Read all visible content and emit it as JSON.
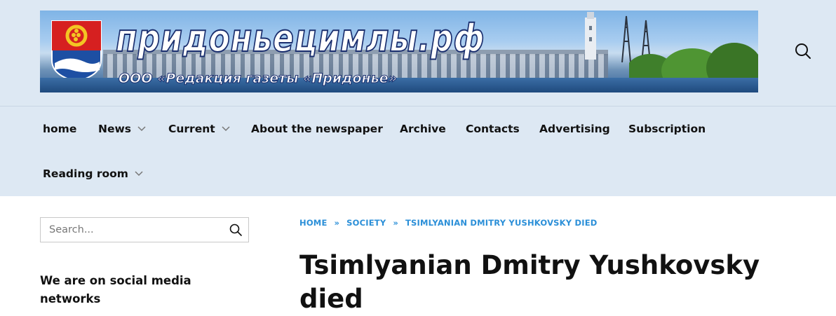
{
  "header": {
    "site_title": "придоньецимлы.рф",
    "site_subtitle": "ООО «Редакция газеты «Придонье»",
    "search_icon": "search-icon"
  },
  "nav": {
    "items": [
      {
        "label": "home",
        "has_dropdown": false
      },
      {
        "label": "News",
        "has_dropdown": true
      },
      {
        "label": "Current",
        "has_dropdown": true
      },
      {
        "label": "About the newspaper",
        "has_dropdown": false
      },
      {
        "label": "Archive",
        "has_dropdown": false
      },
      {
        "label": "Contacts",
        "has_dropdown": false
      },
      {
        "label": "Advertising",
        "has_dropdown": false
      },
      {
        "label": "Subscription",
        "has_dropdown": false
      },
      {
        "label": "Reading room",
        "has_dropdown": true
      }
    ]
  },
  "sidebar": {
    "search_placeholder": "Search...",
    "social_title": "We are on social media networks"
  },
  "breadcrumb": {
    "items": [
      "HOME",
      "SOCIETY",
      "TSIMLYANIAN DMITRY YUSHKOVSKY DIED"
    ],
    "separator": "»"
  },
  "article": {
    "title": "Tsimlyanian Dmitry Yushkovsky died"
  },
  "colors": {
    "header_bg": "#dde8f3",
    "link_blue": "#2b8fd8",
    "text": "#111111"
  }
}
